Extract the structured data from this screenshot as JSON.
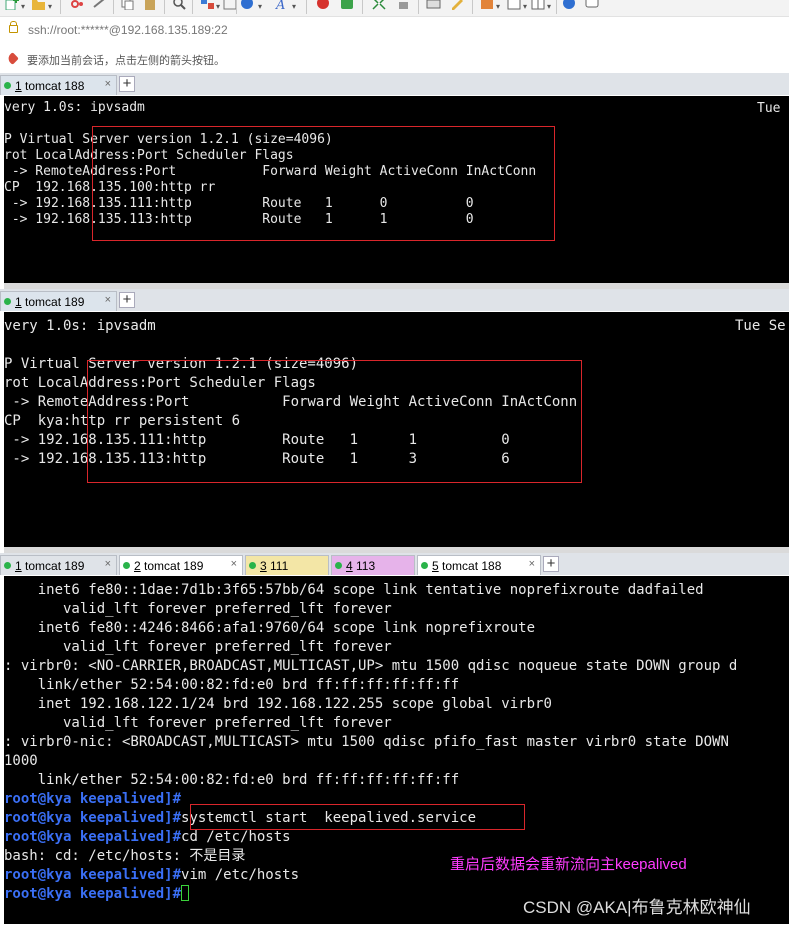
{
  "address": "ssh://root:******@192.168.135.189:22",
  "hint": "要添加当前会话，点击左侧的箭头按钮。",
  "pane1": {
    "tab": {
      "num": "1",
      "name": "tomcat 188",
      "close": "×"
    },
    "lines": [
      "very 1.0s: ipvsadm",
      "",
      "P Virtual Server version 1.2.1 (size=4096)",
      "rot LocalAddress:Port Scheduler Flags",
      " -> RemoteAddress:Port           Forward Weight ActiveConn InActConn",
      "CP  192.168.135.100:http rr",
      " -> 192.168.135.111:http         Route   1      0          0",
      " -> 192.168.135.113:http         Route   1      1          0"
    ],
    "right_text": "Tue"
  },
  "pane2": {
    "tab": {
      "num": "1",
      "name": "tomcat 189",
      "close": "×"
    },
    "lines": [
      "very 1.0s: ipvsadm",
      "",
      "P Virtual Server version 1.2.1 (size=4096)",
      "rot LocalAddress:Port Scheduler Flags",
      " -> RemoteAddress:Port           Forward Weight ActiveConn InActConn",
      "CP  kya:http rr persistent 6",
      " -> 192.168.135.111:http         Route   1      1          0",
      " -> 192.168.135.113:http         Route   1      3          6"
    ],
    "right_text": "Tue Se"
  },
  "pane3": {
    "tabs": [
      {
        "num": "1",
        "name": "tomcat 189",
        "close": "×",
        "color": "#dfe3e8"
      },
      {
        "num": "2",
        "name": "tomcat 189",
        "close": "×",
        "color": "#ffffff"
      },
      {
        "num": "3",
        "name": "111",
        "close": "",
        "color": "#f3e6a6"
      },
      {
        "num": "4",
        "name": "113",
        "close": "",
        "color": "#e6b3ea"
      },
      {
        "num": "5",
        "name": "tomcat 188",
        "close": "×",
        "color": "#ffffff"
      }
    ],
    "output": [
      "    inet6 fe80::1dae:7d1b:3f65:57bb/64 scope link tentative noprefixroute dadfailed",
      "       valid_lft forever preferred_lft forever",
      "    inet6 fe80::4246:8466:afa1:9760/64 scope link noprefixroute",
      "       valid_lft forever preferred_lft forever",
      ": virbr0: <NO-CARRIER,BROADCAST,MULTICAST,UP> mtu 1500 qdisc noqueue state DOWN group d",
      "    link/ether 52:54:00:82:fd:e0 brd ff:ff:ff:ff:ff:ff",
      "    inet 192.168.122.1/24 brd 192.168.122.255 scope global virbr0",
      "       valid_lft forever preferred_lft forever",
      ": virbr0-nic: <BROADCAST,MULTICAST> mtu 1500 qdisc pfifo_fast master virbr0 state DOWN",
      "1000",
      "    link/ether 52:54:00:82:fd:e0 brd ff:ff:ff:ff:ff:ff"
    ],
    "prompt": "root@kya keepalived]#",
    "cmd1": "systemctl start  keepalived.service",
    "cmd2": "cd /etc/hosts",
    "err": "bash: cd: /etc/hosts: 不是目录",
    "cmd3": "vim /etc/hosts",
    "annotation": "重启后数据会重新流向主keepalived",
    "watermark": "CSDN @AKA|布鲁克林欧神仙"
  }
}
